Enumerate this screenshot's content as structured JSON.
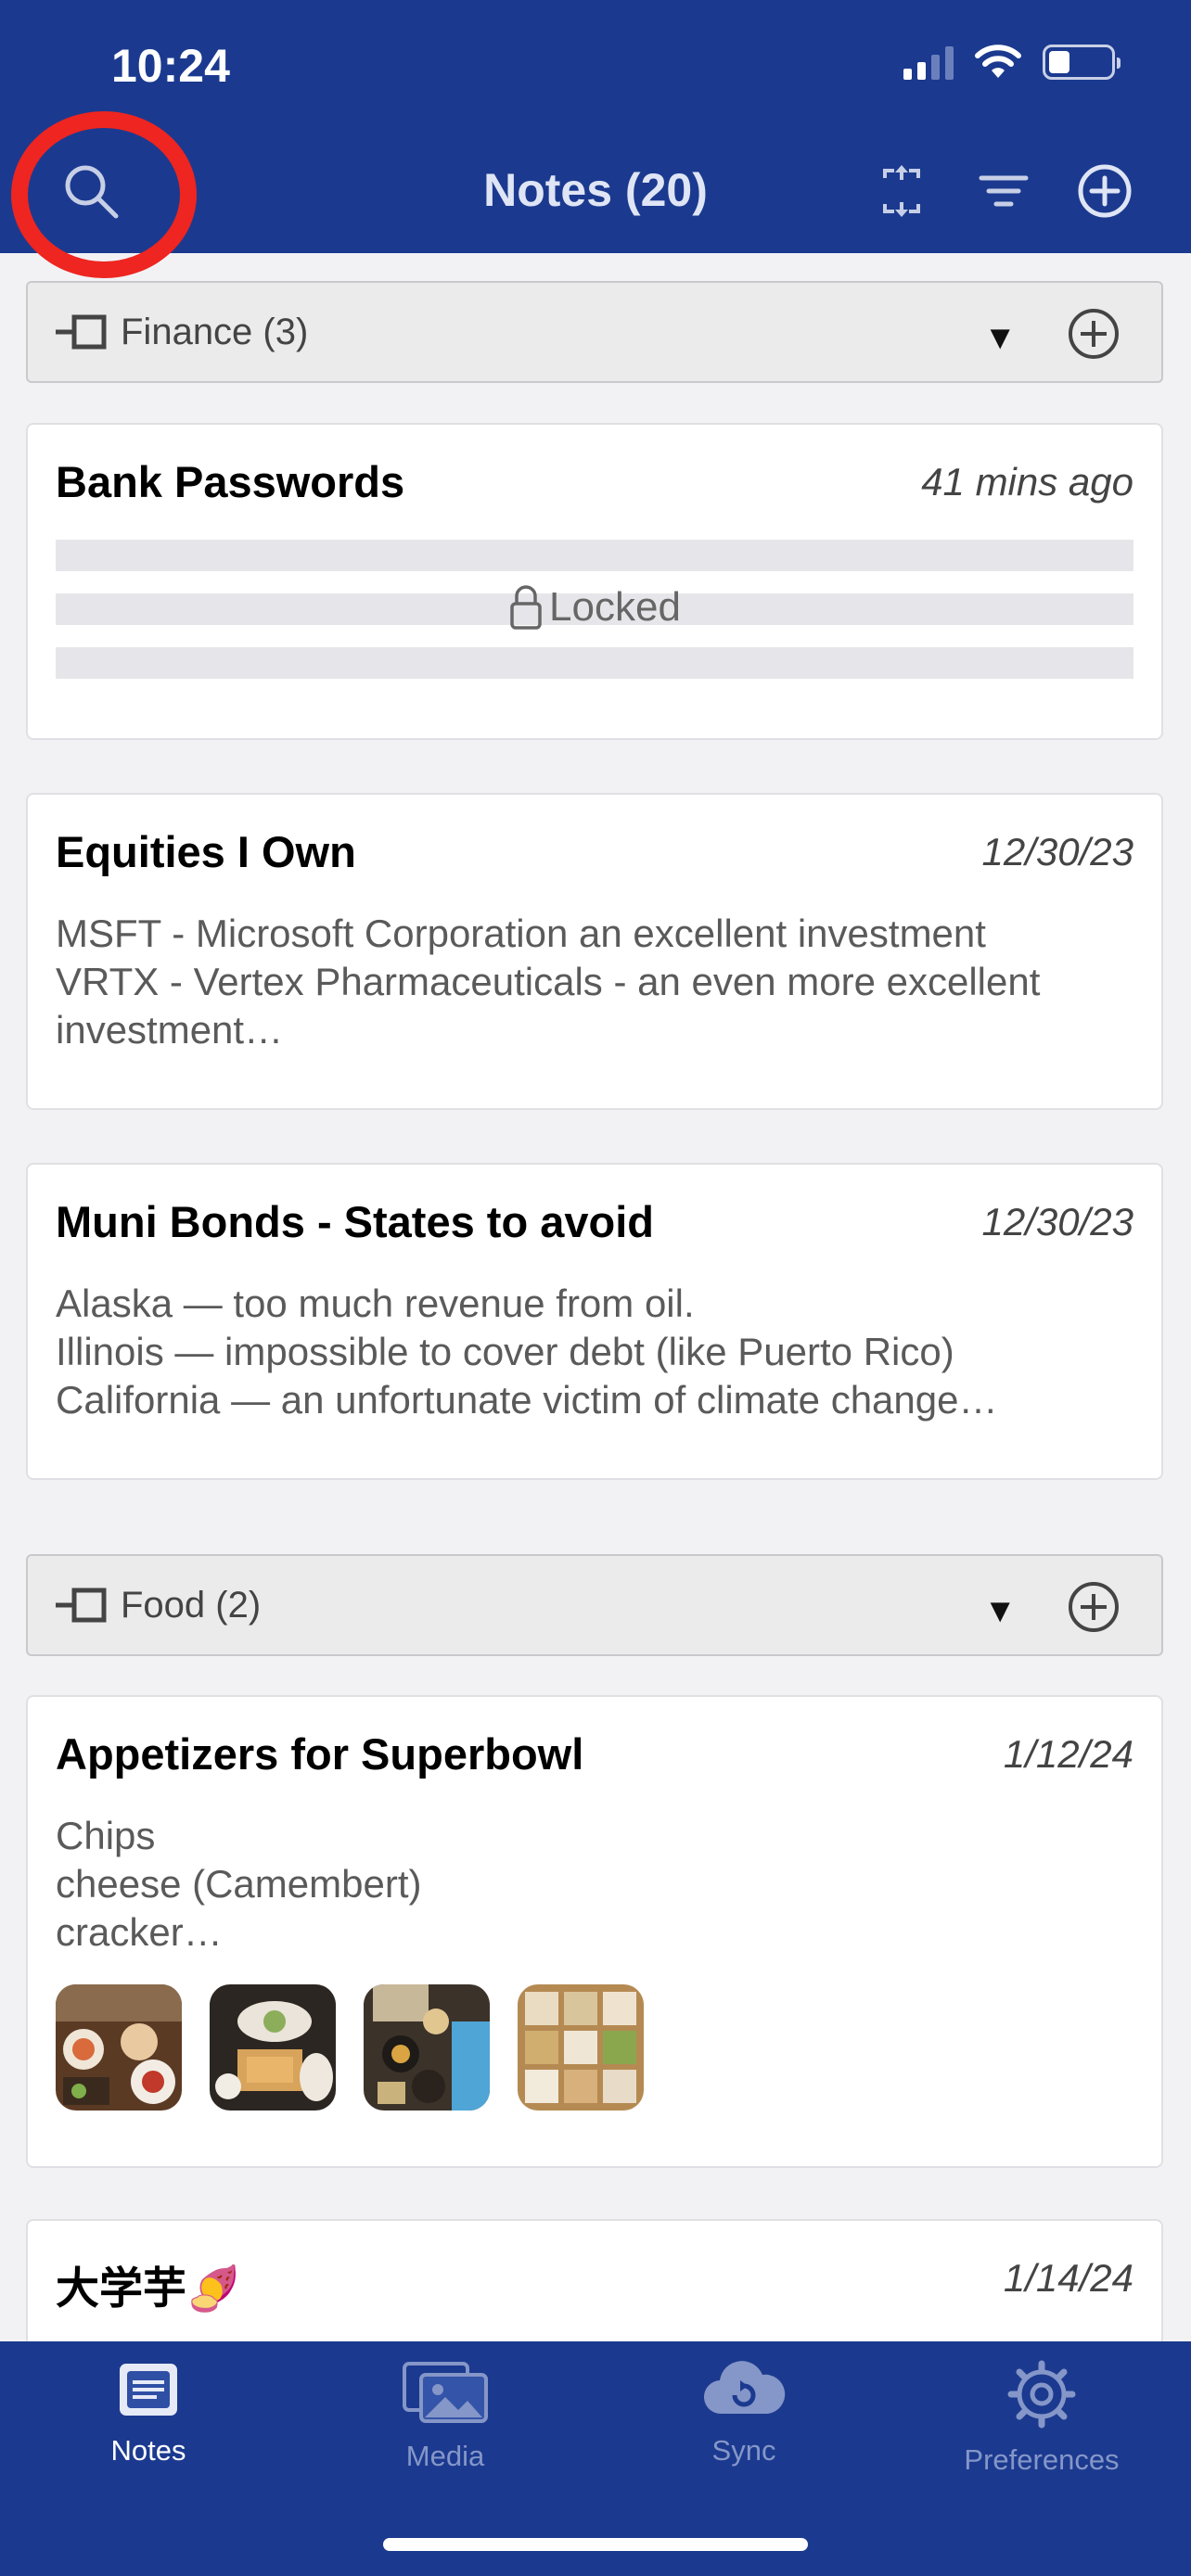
{
  "status_bar": {
    "time": "10:24"
  },
  "header": {
    "title": "Notes (20)"
  },
  "groups": [
    {
      "label": "Finance (3)",
      "notes": [
        {
          "title": "Bank Passwords",
          "date": "41 mins ago",
          "locked_label": "Locked"
        },
        {
          "title": "Equities I Own",
          "date": "12/30/23",
          "body": "MSFT - Microsoft Corporation an excellent investment\nVRTX - Vertex Pharmaceuticals - an even more excellent investment…"
        },
        {
          "title": "Muni Bonds - States to avoid",
          "date": "12/30/23",
          "body": "Alaska — too much revenue from oil.\nIllinois — impossible to cover debt (like Puerto Rico)\nCalifornia — an unfortunate victim of climate change…"
        }
      ]
    },
    {
      "label": "Food (2)",
      "notes": [
        {
          "title": "Appetizers for Superbowl",
          "date": "1/12/24",
          "body": "Chips\ncheese (Camembert)\ncracker…"
        },
        {
          "title": "大学芋🍠",
          "date": "1/14/24"
        }
      ]
    }
  ],
  "tabs": [
    {
      "label": "Notes",
      "icon": "notes-icon",
      "active": true
    },
    {
      "label": "Media",
      "icon": "media-icon",
      "active": false
    },
    {
      "label": "Sync",
      "icon": "sync-cloud-icon",
      "active": false
    },
    {
      "label": "Preferences",
      "icon": "gear-icon",
      "active": false
    }
  ],
  "colors": {
    "nav": "#1b3a8f",
    "highlight": "#ee2520",
    "tab_inactive": "#8596c8"
  }
}
